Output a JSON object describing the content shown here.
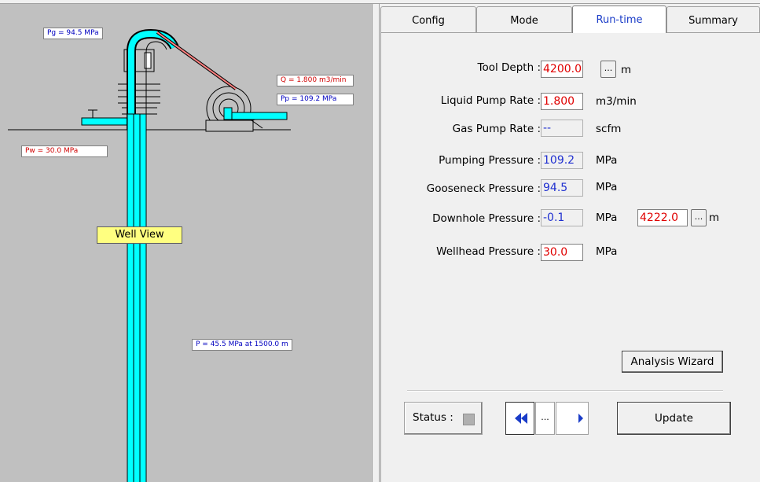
{
  "well": {
    "pg": "Pg = 94.5 MPa",
    "q": "Q = 1.800 m3/min",
    "pp": "Pp = 109.2 MPa",
    "pw": "Pw = 30.0 MPa",
    "title": "Well View",
    "p_depth": "P = 45.5 MPa at 1500.0 m"
  },
  "tabs": [
    {
      "label": "Config",
      "active": false
    },
    {
      "label": "Mode",
      "active": false
    },
    {
      "label": "Run-time",
      "active": true
    },
    {
      "label": "Summary",
      "active": false
    }
  ],
  "runtime": {
    "tool_depth": {
      "label": "Tool Depth :",
      "value": "4200.0",
      "unit": "m"
    },
    "liquid_rate": {
      "label": "Liquid Pump Rate :",
      "value": "1.800",
      "unit": "m3/min"
    },
    "gas_rate": {
      "label": "Gas Pump Rate :",
      "value": "--",
      "unit": "scfm"
    },
    "pumping": {
      "label": "Pumping Pressure :",
      "value": "109.2",
      "unit": "MPa"
    },
    "gooseneck": {
      "label": "Gooseneck Pressure :",
      "value": "94.5",
      "unit": "MPa"
    },
    "downhole": {
      "label": "Downhole Pressure :",
      "value": "-0.1",
      "unit": "MPa",
      "depth": "4222.0",
      "depth_unit": "m"
    },
    "wellhead": {
      "label": "Wellhead Pressure :",
      "value": "30.0",
      "unit": "MPa"
    },
    "analysis_wizard": "Analysis Wizard",
    "status_label": "Status :",
    "dots": "...",
    "update": "Update"
  },
  "colors": {
    "pipe": "#00ffff",
    "accent": "#1a3cc8",
    "red_value": "#e00000",
    "blue_value": "#2030d0"
  }
}
